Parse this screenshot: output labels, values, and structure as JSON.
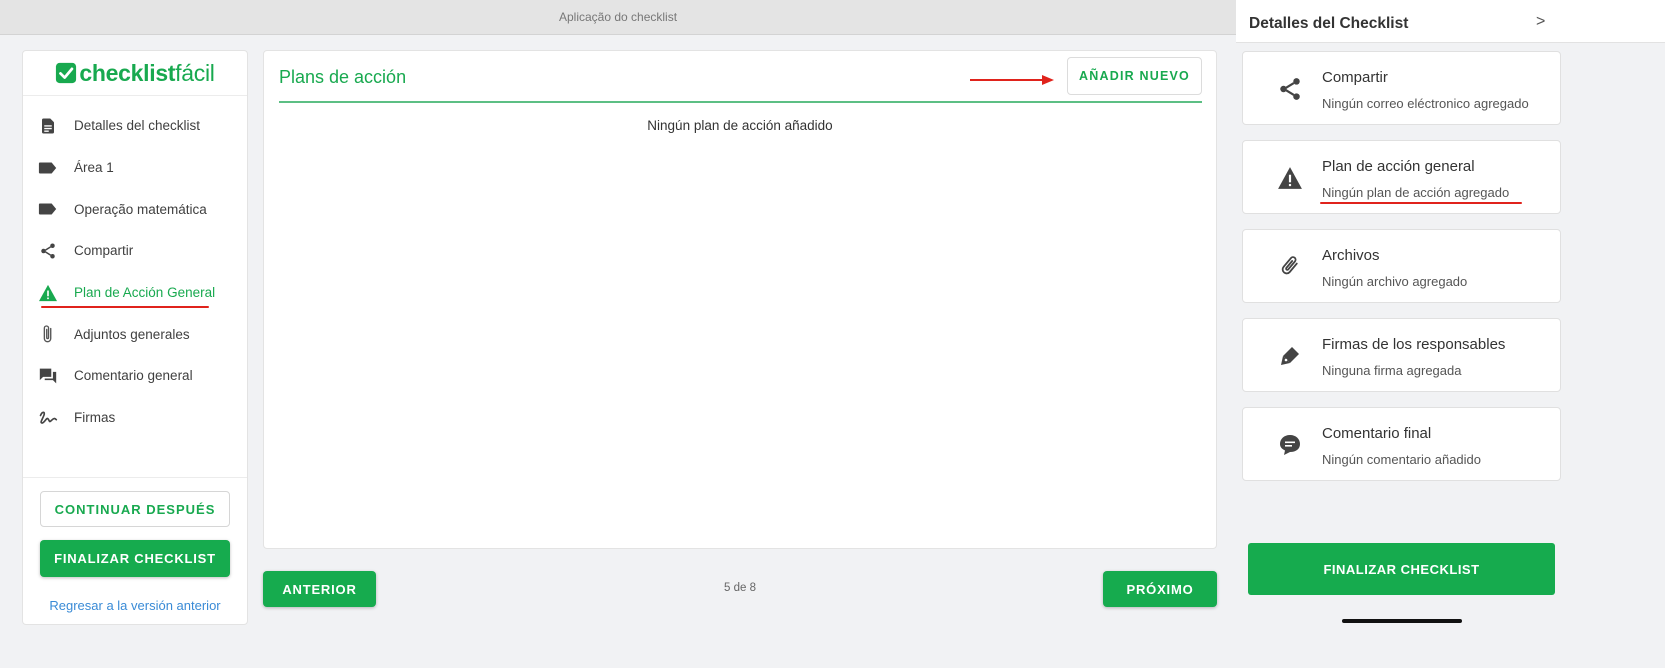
{
  "app": {
    "window_title": "Aplicação do checklist",
    "logo": {
      "bold": "checklist",
      "light": "fácil"
    }
  },
  "sidebar": {
    "items": [
      {
        "label": "Detalles del checklist",
        "icon": "document-icon"
      },
      {
        "label": "Área 1",
        "icon": "label-icon"
      },
      {
        "label": "Operação matemática",
        "icon": "label-icon"
      },
      {
        "label": "Compartir",
        "icon": "share-icon"
      },
      {
        "label": "Plan de Acción General",
        "icon": "warning-icon",
        "active": true
      },
      {
        "label": "Adjuntos generales",
        "icon": "paperclip-icon"
      },
      {
        "label": "Comentario general",
        "icon": "comments-icon"
      },
      {
        "label": "Firmas",
        "icon": "signature-icon"
      }
    ],
    "continue_later": "CONTINUAR DESPUÉS",
    "finish": "FINALIZAR CHECKLIST",
    "back_link": "Regresar a la versión anterior"
  },
  "main": {
    "title": "Plans de acción",
    "add_button": "AÑADIR NUEVO",
    "empty_message": "Ningún plan de acción añadido",
    "prev_button": "ANTERIOR",
    "next_button": "PRÓXIMO",
    "pager": "5 de 8"
  },
  "panel": {
    "title": "Detalles del Checklist",
    "chevron": ">",
    "cards": [
      {
        "title": "Compartir",
        "subtitle": "Ningún correo eléctronico agregado",
        "icon": "share-icon"
      },
      {
        "title": "Plan de acción general",
        "subtitle": "Ningún plan de acción agregado",
        "icon": "warning-icon"
      },
      {
        "title": "Archivos",
        "subtitle": "Ningún archivo agregado",
        "icon": "paperclip-icon"
      },
      {
        "title": "Firmas de los responsables",
        "subtitle": "Ninguna firma agregada",
        "icon": "pen-icon"
      },
      {
        "title": "Comentario final",
        "subtitle": "Ningún comentario añadido",
        "icon": "comment-icon"
      }
    ],
    "finish": "FINALIZAR CHECKLIST"
  },
  "colors": {
    "accent": "#16ab4e",
    "annotation": "#e0231c",
    "link": "#3a8bd6"
  }
}
